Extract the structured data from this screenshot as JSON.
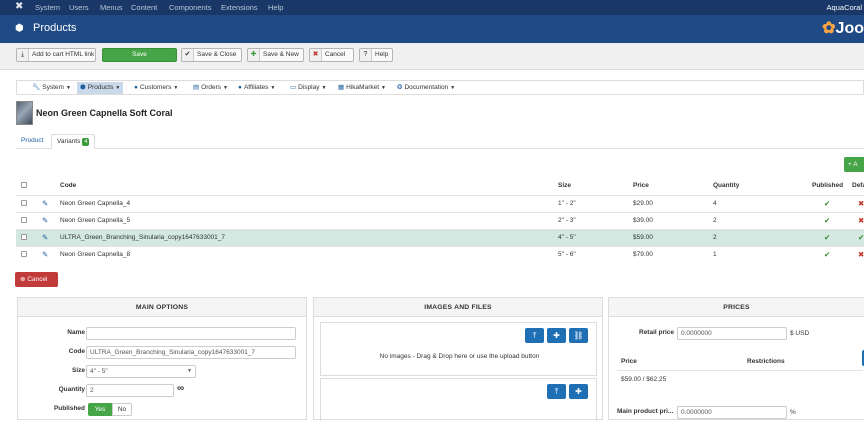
{
  "topnav": {
    "menu": [
      "System",
      "Users",
      "Menus",
      "Content",
      "Components",
      "Extensions",
      "Help"
    ],
    "site_name": "AquaCoral"
  },
  "titlebar": {
    "title": "Products",
    "logo_text": "Joo"
  },
  "toolbar": {
    "add_to_cart": "Add to cart HTML link",
    "save": "Save",
    "save_close": "Save & Close",
    "save_new": "Save & New",
    "cancel": "Cancel",
    "help": "Help"
  },
  "hikamenu": [
    {
      "label": "System",
      "icon": "wrench-icon"
    },
    {
      "label": "Products",
      "icon": "products-icon",
      "active": true
    },
    {
      "label": "Customers",
      "icon": "user-icon"
    },
    {
      "label": "Orders",
      "icon": "cart-icon"
    },
    {
      "label": "Affiliates",
      "icon": "users-icon"
    },
    {
      "label": "Display",
      "icon": "monitor-icon"
    },
    {
      "label": "HikaMarket",
      "icon": "shop-icon"
    },
    {
      "label": "Documentation",
      "icon": "help-icon"
    }
  ],
  "product": {
    "name": "Neon Green Capnella Soft Coral"
  },
  "tabs": {
    "product": "Product",
    "variants": "Variants",
    "variants_count": "4"
  },
  "add_button": "+ A",
  "variants_table": {
    "headers": {
      "code": "Code",
      "size": "Size",
      "price": "Price",
      "quantity": "Quantity",
      "published": "Published",
      "default": "Defa"
    },
    "rows": [
      {
        "code": "Neon Green Capnella_4",
        "size": "1\" - 2\"",
        "price": "$29.00",
        "quantity": "4"
      },
      {
        "code": "Neon Green Capnella_5",
        "size": "2\" - 3\"",
        "price": "$39.00",
        "quantity": "2"
      },
      {
        "code": "ULTRA_Green_Branching_Sinularia_copy1647633001_7",
        "size": "4\" - 5\"",
        "price": "$59.00",
        "quantity": "2"
      },
      {
        "code": "Neon Green Capnella_8",
        "size": "5\" - 6\"",
        "price": "$79.00",
        "quantity": "1"
      }
    ]
  },
  "cancel_button": "Cancel",
  "main_options": {
    "heading": "MAIN OPTIONS",
    "name_label": "Name",
    "name_value": "",
    "code_label": "Code",
    "code_value": "ULTRA_Green_Branching_Sinularia_copy1647633001_7",
    "size_label": "Size",
    "size_value": "4\" - 5\"",
    "quantity_label": "Quantity",
    "quantity_value": "2",
    "published_label": "Published",
    "yes": "Yes",
    "no": "No"
  },
  "images": {
    "heading": "IMAGES AND FILES",
    "no_images": "No images - Drag & Drop here or use the upload button"
  },
  "prices": {
    "heading": "PRICES",
    "retail_label": "Retail price",
    "retail_value": "0.0000000",
    "currency": "$ USD",
    "price_col": "Price",
    "restrictions_col": "Restrictions",
    "price_row": "$59.00 / $62.25",
    "main_product_label": "Main product pri...",
    "main_product_value": "0.0000000",
    "percent": "%"
  }
}
